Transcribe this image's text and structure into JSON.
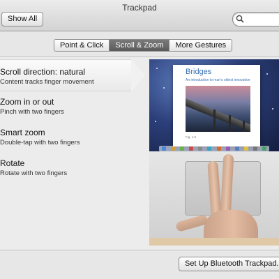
{
  "window": {
    "title": "Trackpad"
  },
  "toolbar": {
    "show_all_label": "Show All",
    "search": {
      "value": "",
      "placeholder": ""
    }
  },
  "tabs": [
    {
      "label": "Point & Click",
      "selected": false
    },
    {
      "label": "Scroll & Zoom",
      "selected": true
    },
    {
      "label": "More Gestures",
      "selected": false
    }
  ],
  "gestures": [
    {
      "title": "Scroll direction: natural",
      "subtitle": "Content tracks finger movement",
      "selected": true
    },
    {
      "title": "Zoom in or out",
      "subtitle": "Pinch with two fingers",
      "selected": false
    },
    {
      "title": "Smart zoom",
      "subtitle": "Double-tap with two fingers",
      "selected": false
    },
    {
      "title": "Rotate",
      "subtitle": "Rotate with two fingers",
      "selected": false
    }
  ],
  "preview": {
    "document_title": "Bridges",
    "document_subtitle": "An introduction to man's oldest innovation",
    "caption": "Fig. 1.0"
  },
  "footer": {
    "bluetooth_button_label": "Set Up Bluetooth Trackpad..."
  },
  "colors": {
    "selected_tab": "#6a6a6a",
    "doc_title": "#3a72b5"
  }
}
